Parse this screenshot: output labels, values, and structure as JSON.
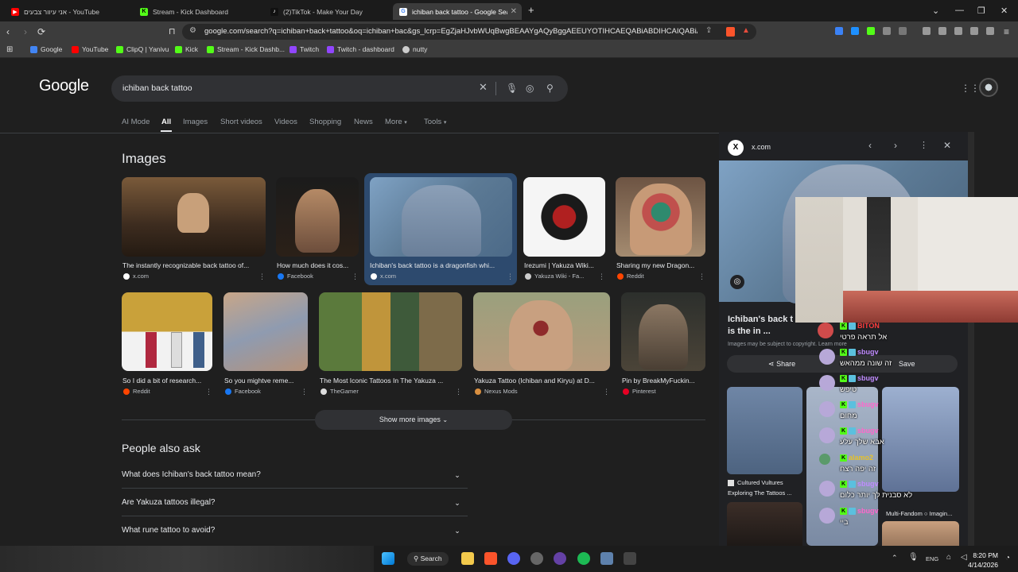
{
  "tabs": [
    {
      "title": "אני עיוור צבעים - YouTube",
      "color": "#ff0000",
      "letter": "▶"
    },
    {
      "title": "Stream - Kick Dashboard",
      "color": "#53fc18",
      "letter": "K"
    },
    {
      "title": "(2)TikTok - Make Your Day",
      "color": "#ffffff",
      "letter": "♪"
    },
    {
      "title": "ichiban back tattoo - Google Sea...",
      "color": "#ffffff",
      "letter": "G"
    }
  ],
  "toolbar": {
    "url": "google.com/search?q=ichiban+back+tattoo&oq=ichiban+bac&gs_lcrp=EgZjaHJvbWUqBwgBEAAYgAQyBggAEEUYOTIHCAEQABiABDIHCAIQABiABDI..."
  },
  "bookmarks": [
    {
      "label": "Google",
      "color": "#4285f4"
    },
    {
      "label": "YouTube",
      "color": "#ff0000"
    },
    {
      "label": "ClipQ | Yanivu",
      "color": "#53fc18"
    },
    {
      "label": "Kick",
      "color": "#53fc18"
    },
    {
      "label": "Stream - Kick Dashb...",
      "color": "#53fc18"
    },
    {
      "label": "Twitch",
      "color": "#9146ff"
    },
    {
      "label": "Twitch - dashboard",
      "color": "#9146ff"
    },
    {
      "label": "nutty",
      "color": "#cccccc"
    }
  ],
  "google": {
    "logo": "Google",
    "query": "ichiban back tattoo",
    "nav": [
      "AI Mode",
      "All",
      "Images",
      "Short videos",
      "Videos",
      "Shopping",
      "News",
      "More",
      "Tools"
    ],
    "images_heading": "Images",
    "row1": [
      {
        "caption": "The instantly recognizable back tattoo of...",
        "source": "x.com",
        "src_color": "#ffffff"
      },
      {
        "caption": "How much does it cos...",
        "source": "Facebook",
        "src_color": "#1877f2"
      },
      {
        "caption": "Ichiban's back tattoo is a dragonfish whi...",
        "source": "x.com",
        "src_color": "#ffffff"
      },
      {
        "caption": "Irezumi | Yakuza Wiki...",
        "source": "Yakuza Wiki - Fa...",
        "src_color": "#cccccc"
      },
      {
        "caption": "Sharing my new Dragon...",
        "source": "Reddit",
        "src_color": "#ff4500"
      }
    ],
    "row2": [
      {
        "caption": "So I did a bit of research...",
        "source": "Reddit",
        "src_color": "#ff4500"
      },
      {
        "caption": "So you mightve reme...",
        "source": "Facebook",
        "src_color": "#1877f2"
      },
      {
        "caption": "The Most Iconic Tattoos In The Yakuza ...",
        "source": "TheGamer",
        "src_color": "#dddddd"
      },
      {
        "caption": "Yakuza Tattoo (Ichiban and Kiryu) at D...",
        "source": "Nexus Mods",
        "src_color": "#d98f40"
      },
      {
        "caption": "Pin by BreakMyFuckin...",
        "source": "Pinterest",
        "src_color": "#e60023"
      }
    ],
    "show_more": "Show more images",
    "paa_heading": "People also ask",
    "paa": [
      "What does Ichiban's back tattoo mean?",
      "Are Yakuza tattoos illegal?",
      "What rune tattoo to avoid?"
    ]
  },
  "panel": {
    "domain": "x.com",
    "title_line1": "Ichiban's back t",
    "title_line2": "is the in ...",
    "notice": "Images may be subject to copyright. Learn more",
    "share": "Share",
    "save": "Save",
    "related1_source": "Cultured Vultures",
    "related1_caption": "Exploring The Tattoos ...",
    "related2_caption": "Multi-Fandom ○ Imagin..."
  },
  "chat": [
    {
      "name": "BITON",
      "msg": "אל תראה פרטי",
      "color": "#ff3b3b"
    },
    {
      "name": "sbugv",
      "msg": "זה שונה ממהאש",
      "color": "#c08bff"
    },
    {
      "name": "sbugv",
      "msg": "טיפש",
      "color": "#c08bff"
    },
    {
      "name": "sbugv",
      "msg": "מחום",
      "color": "#ff66cc"
    },
    {
      "name": "sbugv",
      "msg": "אבא שלך עלע",
      "color": "#ff66cc"
    },
    {
      "name": "alamo2",
      "msg": "זה יפה רצח",
      "color": "#e6c229"
    },
    {
      "name": "sbugv",
      "msg": "לא סבנית לך יותר כלום",
      "color": "#c08bff"
    },
    {
      "name": "sbugv",
      "msg": "ביי",
      "color": "#ff66cc"
    }
  ],
  "taskbar": {
    "search": "Search",
    "lang": "ENG",
    "time": "8:20 PM",
    "date": "4/14/2026"
  }
}
